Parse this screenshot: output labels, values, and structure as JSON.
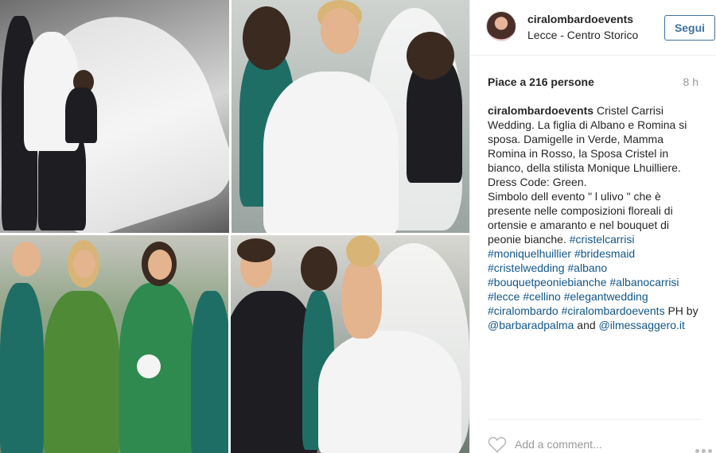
{
  "post": {
    "username": "ciralombardoevents",
    "location": "Lecce - Centro Storico",
    "follow_label": "Segui",
    "likes": "Piace a 216 persone",
    "time_ago": "8 h",
    "caption": {
      "author": "ciralombardoevents",
      "segments": [
        {
          "text": " Cristel Carrisi Wedding. La figlia di Albano e Romina si sposa. Damigelle in Verde, Mamma Romina in Rosso, la Sposa Cristel in bianco, della stilista Monique Lhuilliere.",
          "tag": false
        },
        {
          "br": true
        },
        {
          "text": "Dress Code: Green.",
          "tag": false
        },
        {
          "br": true
        },
        {
          "text": "Simbolo dell evento \" l ulivo \" che è presente nelle composizioni floreali di ortensie e amaranto e nel bouquet di peonie bianche. ",
          "tag": false
        },
        {
          "text": "#cristelcarrisi",
          "tag": true
        },
        {
          "text": " ",
          "tag": false
        },
        {
          "text": "#moniquelhuillier",
          "tag": true
        },
        {
          "text": " ",
          "tag": false
        },
        {
          "text": "#bridesmaid",
          "tag": true
        },
        {
          "text": " ",
          "tag": false
        },
        {
          "text": "#cristelwedding",
          "tag": true
        },
        {
          "text": " ",
          "tag": false
        },
        {
          "text": "#albano",
          "tag": true
        },
        {
          "text": " ",
          "tag": false
        },
        {
          "text": "#bouquetpeoniebianche",
          "tag": true
        },
        {
          "text": " ",
          "tag": false
        },
        {
          "text": "#albanocarrisi",
          "tag": true
        },
        {
          "text": " ",
          "tag": false
        },
        {
          "text": "#lecce",
          "tag": true
        },
        {
          "text": " ",
          "tag": false
        },
        {
          "text": "#cellino",
          "tag": true
        },
        {
          "text": " ",
          "tag": false
        },
        {
          "text": "#elegantwedding",
          "tag": true
        },
        {
          "text": " ",
          "tag": false
        },
        {
          "text": "#ciralombardo",
          "tag": true
        },
        {
          "text": " ",
          "tag": false
        },
        {
          "text": "#ciralombardoevents",
          "tag": true
        },
        {
          "text": " PH by ",
          "tag": false
        },
        {
          "text": "@barbaradpalma",
          "tag": true
        },
        {
          "text": " and ",
          "tag": false
        },
        {
          "text": "@ilmessaggero.it",
          "tag": true
        }
      ]
    },
    "comment_placeholder": "Add a comment...",
    "icons": {
      "like": "heart-icon",
      "more": "more-options-icon"
    },
    "colors": {
      "link": "#125688",
      "follow": "#3f729b",
      "muted": "#999999"
    }
  }
}
